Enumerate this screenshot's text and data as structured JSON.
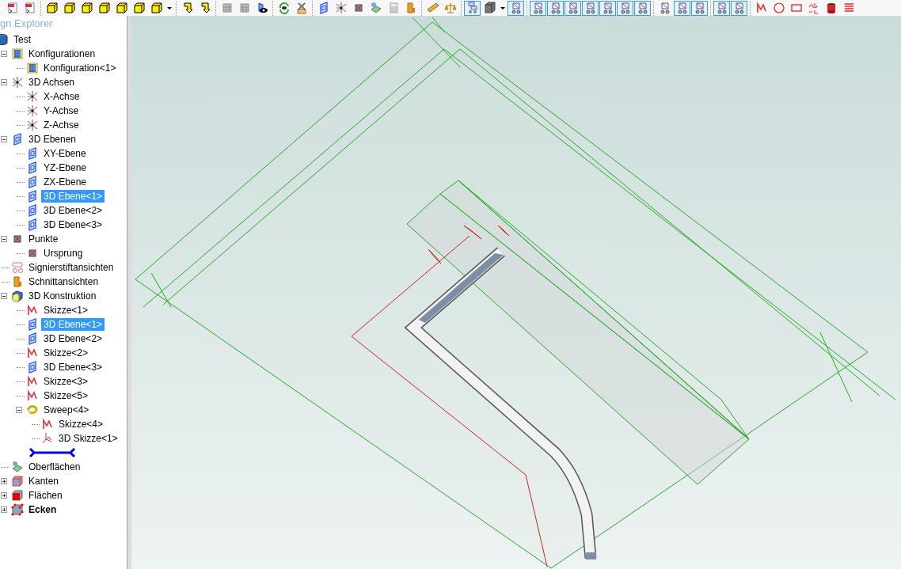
{
  "toolbar": {
    "groups": [
      [
        {
          "kind": "pdf",
          "on": false
        },
        {
          "kind": "pdf",
          "on": false
        }
      ],
      [
        {
          "kind": "cube",
          "on": false
        },
        {
          "kind": "cube",
          "on": false
        },
        {
          "kind": "cube",
          "on": false
        },
        {
          "kind": "cube",
          "on": false
        },
        {
          "kind": "cube",
          "on": false
        },
        {
          "kind": "cube",
          "on": false
        },
        {
          "kind": "cube",
          "on": false
        },
        {
          "kind": "caret",
          "on": false
        }
      ],
      [
        {
          "kind": "arrow",
          "on": false
        },
        {
          "kind": "arrow",
          "on": false
        }
      ],
      [
        {
          "kind": "mesh",
          "on": false
        },
        {
          "kind": "mesh",
          "on": false
        },
        {
          "kind": "eye",
          "on": false
        }
      ],
      [
        {
          "kind": "rotate",
          "on": false
        },
        {
          "kind": "clear",
          "on": false
        }
      ],
      [
        {
          "kind": "plane",
          "on": false
        },
        {
          "kind": "axis",
          "on": false
        },
        {
          "kind": "point",
          "on": false
        },
        {
          "kind": "surface",
          "on": false
        },
        {
          "kind": "calculator",
          "on": false
        },
        {
          "kind": "section",
          "on": false
        }
      ],
      [
        {
          "kind": "ruler",
          "on": false
        },
        {
          "kind": "scale",
          "on": false
        }
      ],
      [
        {
          "kind": "tree",
          "on": true
        },
        {
          "kind": "solid",
          "on": false
        },
        {
          "kind": "caret",
          "on": false
        },
        {
          "kind": "wheeled",
          "on": true
        }
      ],
      [
        {
          "kind": "wheeled",
          "on": true
        },
        {
          "kind": "wheeled",
          "on": true
        },
        {
          "kind": "wheeled",
          "on": true
        },
        {
          "kind": "wheeled",
          "on": true
        },
        {
          "kind": "wheeled",
          "on": true
        },
        {
          "kind": "wheeled",
          "on": true
        },
        {
          "kind": "wheeled",
          "on": true
        }
      ],
      [
        {
          "kind": "wheeled",
          "on": false
        },
        {
          "kind": "wheeled",
          "on": true
        },
        {
          "kind": "wheeled",
          "on": true
        }
      ],
      [
        {
          "kind": "wheeled",
          "on": true
        },
        {
          "kind": "wheeled",
          "on": true
        }
      ],
      [
        {
          "kind": "sketch",
          "on": false
        },
        {
          "kind": "circle",
          "on": false
        },
        {
          "kind": "rectangle",
          "on": false
        },
        {
          "kind": "text",
          "on": false
        },
        {
          "kind": "paint",
          "on": false
        },
        {
          "kind": "lines",
          "on": false
        }
      ]
    ]
  },
  "explorer": {
    "title": "gn Explorer",
    "tree": [
      {
        "label": "Test",
        "kind": "root",
        "selected": false,
        "bold": false,
        "children": [
          {
            "label": "Konfigurationen",
            "kind": "config",
            "selected": false,
            "bold": false,
            "expanded": true,
            "children": [
              {
                "label": "Konfiguration<1>",
                "kind": "config",
                "selected": false,
                "bold": false
              }
            ]
          },
          {
            "label": "3D Achsen",
            "kind": "axis",
            "selected": false,
            "bold": false,
            "expanded": true,
            "children": [
              {
                "label": "X-Achse",
                "kind": "axis",
                "selected": false,
                "bold": false
              },
              {
                "label": "Y-Achse",
                "kind": "axis",
                "selected": false,
                "bold": false
              },
              {
                "label": "Z-Achse",
                "kind": "axis",
                "selected": false,
                "bold": false
              }
            ]
          },
          {
            "label": "3D Ebenen",
            "kind": "plane",
            "selected": false,
            "bold": false,
            "expanded": true,
            "children": [
              {
                "label": "XY-Ebene",
                "kind": "plane",
                "selected": false,
                "bold": false
              },
              {
                "label": "YZ-Ebene",
                "kind": "plane",
                "selected": false,
                "bold": false
              },
              {
                "label": "ZX-Ebene",
                "kind": "plane",
                "selected": false,
                "bold": false
              },
              {
                "label": "3D Ebene<1>",
                "kind": "plane",
                "selected": true,
                "bold": false
              },
              {
                "label": "3D Ebene<2>",
                "kind": "plane",
                "selected": false,
                "bold": false
              },
              {
                "label": "3D Ebene<3>",
                "kind": "plane",
                "selected": false,
                "bold": false
              }
            ]
          },
          {
            "label": "Punkte",
            "kind": "point",
            "selected": false,
            "bold": false,
            "expanded": true,
            "children": [
              {
                "label": "Ursprung",
                "kind": "point",
                "selected": false,
                "bold": false
              }
            ]
          },
          {
            "label": "Signierstiftansichten",
            "kind": "markup",
            "selected": false,
            "bold": false
          },
          {
            "label": "Schnittansichten",
            "kind": "section",
            "selected": false,
            "bold": false
          },
          {
            "label": "3D Konstruktion",
            "kind": "construction",
            "selected": false,
            "bold": false,
            "expanded": true,
            "children": [
              {
                "label": "Skizze<1>",
                "kind": "sketch",
                "selected": false,
                "bold": false
              },
              {
                "label": "3D Ebene<1>",
                "kind": "plane",
                "selected": true,
                "bold": false
              },
              {
                "label": "3D Ebene<2>",
                "kind": "plane",
                "selected": false,
                "bold": false
              },
              {
                "label": "Skizze<2>",
                "kind": "sketch",
                "selected": false,
                "bold": false
              },
              {
                "label": "3D Ebene<3>",
                "kind": "plane",
                "selected": false,
                "bold": false
              },
              {
                "label": "Skizze<3>",
                "kind": "sketch",
                "selected": false,
                "bold": false
              },
              {
                "label": "Skizze<5>",
                "kind": "sketch",
                "selected": false,
                "bold": false
              },
              {
                "label": "Sweep<4>",
                "kind": "sweep",
                "selected": false,
                "bold": false,
                "expanded": true,
                "children": [
                  {
                    "label": "Skizze<4>",
                    "kind": "sketch",
                    "selected": false,
                    "bold": false
                  },
                  {
                    "label": "3D Skizze<1>",
                    "kind": "sketch3d",
                    "selected": false,
                    "bold": false
                  }
                ]
              },
              {
                "kind": "drop-marker"
              }
            ]
          },
          {
            "label": "Oberflächen",
            "kind": "surface",
            "selected": false,
            "bold": false
          },
          {
            "label": "Kanten",
            "kind": "edge",
            "selected": false,
            "bold": false,
            "expanded": false
          },
          {
            "label": "Flächen",
            "kind": "face",
            "selected": false,
            "bold": false,
            "expanded": false
          },
          {
            "label": "Ecken",
            "kind": "vertex",
            "selected": false,
            "bold": true,
            "expanded": false
          }
        ]
      }
    ]
  }
}
